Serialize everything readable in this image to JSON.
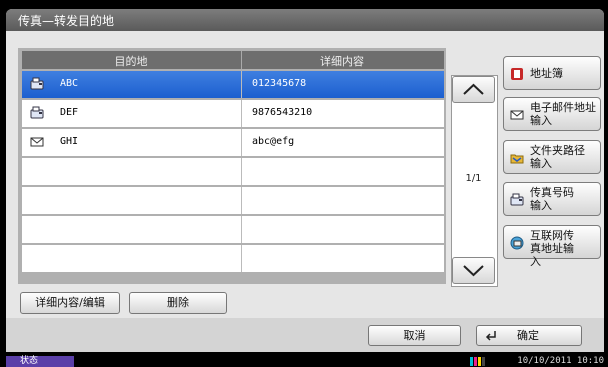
{
  "window": {
    "title": "传真—转发目的地"
  },
  "list": {
    "headers": {
      "destination": "目的地",
      "details": "详细内容"
    },
    "rows": [
      {
        "name": "ABC",
        "detail": "012345678",
        "icon": "fax-icon",
        "selected": true
      },
      {
        "name": "DEF",
        "detail": "9876543210",
        "icon": "fax-icon",
        "selected": false
      },
      {
        "name": "GHI",
        "detail": "abc@efg",
        "icon": "email-icon",
        "selected": false
      },
      {
        "name": "",
        "detail": "",
        "icon": "",
        "selected": false
      },
      {
        "name": "",
        "detail": "",
        "icon": "",
        "selected": false
      },
      {
        "name": "",
        "detail": "",
        "icon": "",
        "selected": false
      },
      {
        "name": "",
        "detail": "",
        "icon": "",
        "selected": false
      }
    ]
  },
  "pager": {
    "page": "1/1"
  },
  "side_buttons": [
    {
      "label": "地址簿",
      "icon": "address-book-icon"
    },
    {
      "label": "电子邮件地址输入",
      "icon": "email-icon"
    },
    {
      "label": "文件夹路径输入",
      "icon": "folder-icon"
    },
    {
      "label": "传真号码输入",
      "icon": "fax-icon"
    },
    {
      "label": "互联网传真地址输入",
      "icon": "internet-fax-icon"
    }
  ],
  "actions": {
    "detail_edit": "详细内容/编辑",
    "delete": "删除"
  },
  "footer": {
    "cancel": "取消",
    "confirm": "确定"
  },
  "status": {
    "label": "状态",
    "datetime": "10/10/2011  10:10"
  },
  "colors": {
    "selected_row": "#1c5fcf",
    "status_badge": "#5a3fa8",
    "address_book_icon": "#c62828"
  }
}
